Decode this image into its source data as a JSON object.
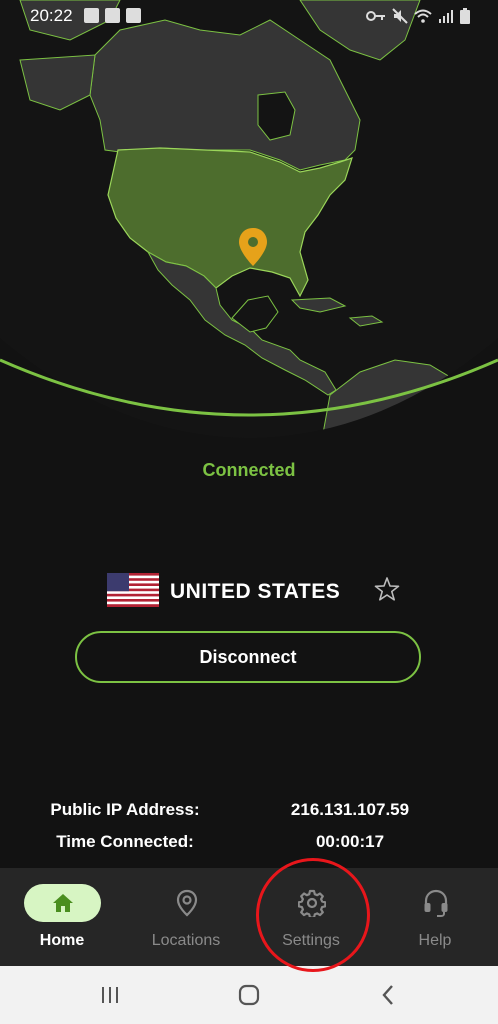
{
  "status_bar": {
    "time": "20:22"
  },
  "map": {
    "marker_icon": "location-pin-icon",
    "accent": "#7cc243",
    "pin_color": "#e6a21a"
  },
  "connection": {
    "status": "Connected",
    "country": "UNITED STATES",
    "action_label": "Disconnect"
  },
  "info": {
    "ip_label": "Public IP Address:",
    "ip_value": "216.131.107.59",
    "time_label": "Time Connected:",
    "time_value": "00:00:17"
  },
  "nav": {
    "items": [
      {
        "label": "Home",
        "icon": "home-icon",
        "active": true
      },
      {
        "label": "Locations",
        "icon": "location-pin-icon",
        "active": false
      },
      {
        "label": "Settings",
        "icon": "gear-icon",
        "active": false
      },
      {
        "label": "Help",
        "icon": "headset-icon",
        "active": false
      }
    ]
  },
  "colors": {
    "accent": "#7cc243",
    "nav_active_bg": "#d7f5c3",
    "annotation": "#e8161b"
  }
}
